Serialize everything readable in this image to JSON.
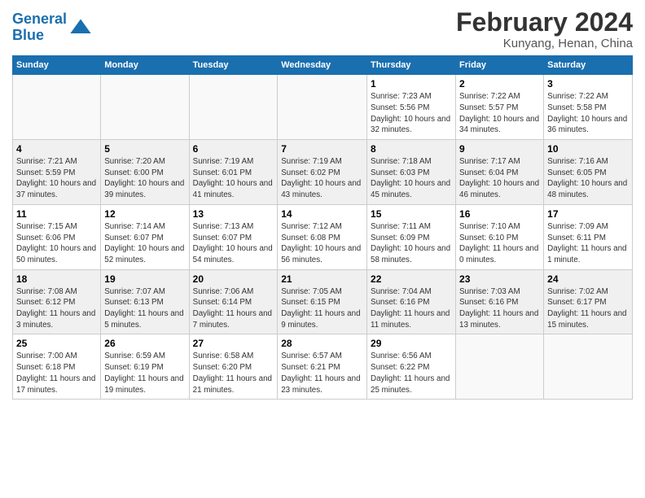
{
  "logo": {
    "line1": "General",
    "line2": "Blue"
  },
  "title": "February 2024",
  "subtitle": "Kunyang, Henan, China",
  "days_of_week": [
    "Sunday",
    "Monday",
    "Tuesday",
    "Wednesday",
    "Thursday",
    "Friday",
    "Saturday"
  ],
  "weeks": [
    [
      {
        "day": "",
        "sunrise": "",
        "sunset": "",
        "daylight": ""
      },
      {
        "day": "",
        "sunrise": "",
        "sunset": "",
        "daylight": ""
      },
      {
        "day": "",
        "sunrise": "",
        "sunset": "",
        "daylight": ""
      },
      {
        "day": "",
        "sunrise": "",
        "sunset": "",
        "daylight": ""
      },
      {
        "day": "1",
        "sunrise": "Sunrise: 7:23 AM",
        "sunset": "Sunset: 5:56 PM",
        "daylight": "Daylight: 10 hours and 32 minutes."
      },
      {
        "day": "2",
        "sunrise": "Sunrise: 7:22 AM",
        "sunset": "Sunset: 5:57 PM",
        "daylight": "Daylight: 10 hours and 34 minutes."
      },
      {
        "day": "3",
        "sunrise": "Sunrise: 7:22 AM",
        "sunset": "Sunset: 5:58 PM",
        "daylight": "Daylight: 10 hours and 36 minutes."
      }
    ],
    [
      {
        "day": "4",
        "sunrise": "Sunrise: 7:21 AM",
        "sunset": "Sunset: 5:59 PM",
        "daylight": "Daylight: 10 hours and 37 minutes."
      },
      {
        "day": "5",
        "sunrise": "Sunrise: 7:20 AM",
        "sunset": "Sunset: 6:00 PM",
        "daylight": "Daylight: 10 hours and 39 minutes."
      },
      {
        "day": "6",
        "sunrise": "Sunrise: 7:19 AM",
        "sunset": "Sunset: 6:01 PM",
        "daylight": "Daylight: 10 hours and 41 minutes."
      },
      {
        "day": "7",
        "sunrise": "Sunrise: 7:19 AM",
        "sunset": "Sunset: 6:02 PM",
        "daylight": "Daylight: 10 hours and 43 minutes."
      },
      {
        "day": "8",
        "sunrise": "Sunrise: 7:18 AM",
        "sunset": "Sunset: 6:03 PM",
        "daylight": "Daylight: 10 hours and 45 minutes."
      },
      {
        "day": "9",
        "sunrise": "Sunrise: 7:17 AM",
        "sunset": "Sunset: 6:04 PM",
        "daylight": "Daylight: 10 hours and 46 minutes."
      },
      {
        "day": "10",
        "sunrise": "Sunrise: 7:16 AM",
        "sunset": "Sunset: 6:05 PM",
        "daylight": "Daylight: 10 hours and 48 minutes."
      }
    ],
    [
      {
        "day": "11",
        "sunrise": "Sunrise: 7:15 AM",
        "sunset": "Sunset: 6:06 PM",
        "daylight": "Daylight: 10 hours and 50 minutes."
      },
      {
        "day": "12",
        "sunrise": "Sunrise: 7:14 AM",
        "sunset": "Sunset: 6:07 PM",
        "daylight": "Daylight: 10 hours and 52 minutes."
      },
      {
        "day": "13",
        "sunrise": "Sunrise: 7:13 AM",
        "sunset": "Sunset: 6:07 PM",
        "daylight": "Daylight: 10 hours and 54 minutes."
      },
      {
        "day": "14",
        "sunrise": "Sunrise: 7:12 AM",
        "sunset": "Sunset: 6:08 PM",
        "daylight": "Daylight: 10 hours and 56 minutes."
      },
      {
        "day": "15",
        "sunrise": "Sunrise: 7:11 AM",
        "sunset": "Sunset: 6:09 PM",
        "daylight": "Daylight: 10 hours and 58 minutes."
      },
      {
        "day": "16",
        "sunrise": "Sunrise: 7:10 AM",
        "sunset": "Sunset: 6:10 PM",
        "daylight": "Daylight: 11 hours and 0 minutes."
      },
      {
        "day": "17",
        "sunrise": "Sunrise: 7:09 AM",
        "sunset": "Sunset: 6:11 PM",
        "daylight": "Daylight: 11 hours and 1 minute."
      }
    ],
    [
      {
        "day": "18",
        "sunrise": "Sunrise: 7:08 AM",
        "sunset": "Sunset: 6:12 PM",
        "daylight": "Daylight: 11 hours and 3 minutes."
      },
      {
        "day": "19",
        "sunrise": "Sunrise: 7:07 AM",
        "sunset": "Sunset: 6:13 PM",
        "daylight": "Daylight: 11 hours and 5 minutes."
      },
      {
        "day": "20",
        "sunrise": "Sunrise: 7:06 AM",
        "sunset": "Sunset: 6:14 PM",
        "daylight": "Daylight: 11 hours and 7 minutes."
      },
      {
        "day": "21",
        "sunrise": "Sunrise: 7:05 AM",
        "sunset": "Sunset: 6:15 PM",
        "daylight": "Daylight: 11 hours and 9 minutes."
      },
      {
        "day": "22",
        "sunrise": "Sunrise: 7:04 AM",
        "sunset": "Sunset: 6:16 PM",
        "daylight": "Daylight: 11 hours and 11 minutes."
      },
      {
        "day": "23",
        "sunrise": "Sunrise: 7:03 AM",
        "sunset": "Sunset: 6:16 PM",
        "daylight": "Daylight: 11 hours and 13 minutes."
      },
      {
        "day": "24",
        "sunrise": "Sunrise: 7:02 AM",
        "sunset": "Sunset: 6:17 PM",
        "daylight": "Daylight: 11 hours and 15 minutes."
      }
    ],
    [
      {
        "day": "25",
        "sunrise": "Sunrise: 7:00 AM",
        "sunset": "Sunset: 6:18 PM",
        "daylight": "Daylight: 11 hours and 17 minutes."
      },
      {
        "day": "26",
        "sunrise": "Sunrise: 6:59 AM",
        "sunset": "Sunset: 6:19 PM",
        "daylight": "Daylight: 11 hours and 19 minutes."
      },
      {
        "day": "27",
        "sunrise": "Sunrise: 6:58 AM",
        "sunset": "Sunset: 6:20 PM",
        "daylight": "Daylight: 11 hours and 21 minutes."
      },
      {
        "day": "28",
        "sunrise": "Sunrise: 6:57 AM",
        "sunset": "Sunset: 6:21 PM",
        "daylight": "Daylight: 11 hours and 23 minutes."
      },
      {
        "day": "29",
        "sunrise": "Sunrise: 6:56 AM",
        "sunset": "Sunset: 6:22 PM",
        "daylight": "Daylight: 11 hours and 25 minutes."
      },
      {
        "day": "",
        "sunrise": "",
        "sunset": "",
        "daylight": ""
      },
      {
        "day": "",
        "sunrise": "",
        "sunset": "",
        "daylight": ""
      }
    ]
  ]
}
